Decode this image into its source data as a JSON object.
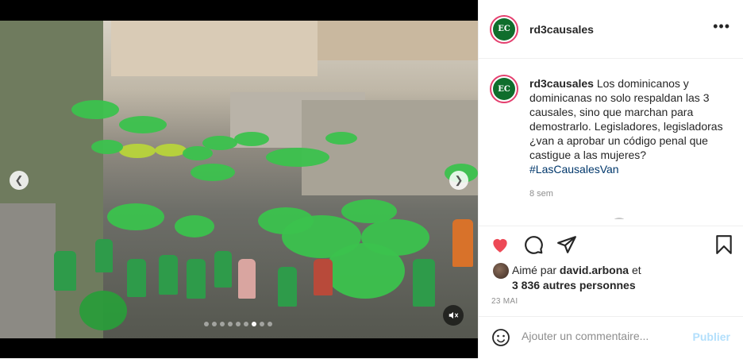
{
  "post": {
    "username": "rd3causales",
    "avatar_initials": "EC",
    "caption_user": "rd3causales",
    "caption_text": " Los dominicanos y dominicanas no solo respaldan las 3 causales, sino que marchan para demostrarlo. Legisladores, legisladoras ¿van a aprobar un código penal que castigue a las mujeres? ",
    "caption_hashtag": "#LasCausalesVan",
    "caption_age": "8 sem",
    "likes_prefix": "Aimé par ",
    "likes_user": "david.arbona",
    "likes_suffix": " et",
    "likes_others": "3 836 autres personnes",
    "date": "23 MAI"
  },
  "comment": {
    "placeholder": "Ajouter un commentaire...",
    "publish_label": "Publier"
  },
  "carousel": {
    "slide_count": 9,
    "active_index": 6
  },
  "icons": {
    "like": "heart-icon",
    "comment": "comment-icon",
    "share": "paper-plane-icon",
    "save": "bookmark-icon",
    "emoji": "emoji-icon",
    "more": "more-options-icon",
    "mute": "muted-speaker-icon",
    "prev": "chevron-left-icon",
    "next": "chevron-right-icon"
  },
  "colors": {
    "like_active": "#ed4956",
    "publish_disabled": "#b2dffc",
    "hashtag": "#00376b",
    "brand_green": "#0f6e2c"
  }
}
